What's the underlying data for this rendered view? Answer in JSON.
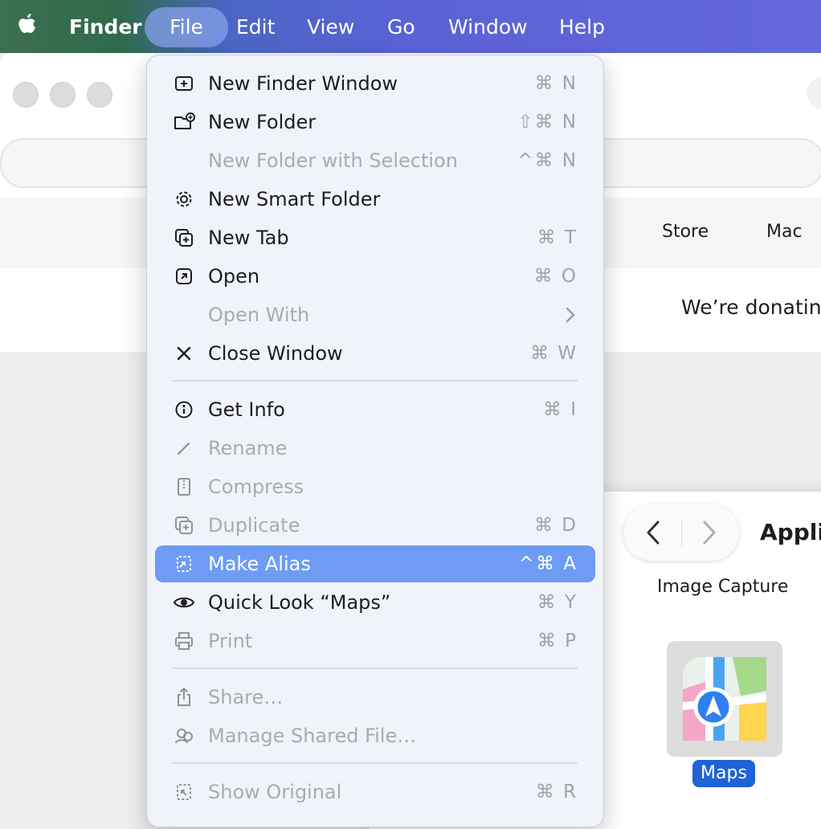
{
  "menubar": {
    "apple_icon": "apple-logo-icon",
    "items": [
      "Finder",
      "File",
      "Edit",
      "View",
      "Go",
      "Window",
      "Help"
    ],
    "active_item": "File"
  },
  "browser": {
    "nav_items": [
      "Store",
      "Mac"
    ],
    "banner_text": "We’re donatin"
  },
  "finder_window": {
    "title": "Applic",
    "above_item_label": "Image Capture",
    "selected_item_label": "Maps",
    "selected_item_icon": "maps-app-icon"
  },
  "file_menu": {
    "items": [
      {
        "label": "New Finder Window",
        "shortcut": "⌘ N",
        "icon": "new-window-icon",
        "enabled": true
      },
      {
        "label": "New Folder",
        "shortcut": "⇧⌘ N",
        "icon": "new-folder-icon",
        "enabled": true
      },
      {
        "label": "New Folder with Selection",
        "shortcut": "^⌘ N",
        "icon": "",
        "enabled": false
      },
      {
        "label": "New Smart Folder",
        "shortcut": "",
        "icon": "gear-icon",
        "enabled": true
      },
      {
        "label": "New Tab",
        "shortcut": "⌘ T",
        "icon": "new-tab-icon",
        "enabled": true
      },
      {
        "label": "Open",
        "shortcut": "⌘ O",
        "icon": "open-arrow-icon",
        "enabled": true
      },
      {
        "label": "Open With",
        "shortcut": "",
        "icon": "",
        "enabled": false,
        "submenu": true
      },
      {
        "label": "Close Window",
        "shortcut": "⌘ W",
        "icon": "close-icon",
        "enabled": true
      },
      {
        "label": "Get Info",
        "shortcut": "⌘ I",
        "icon": "info-icon",
        "enabled": true
      },
      {
        "label": "Rename",
        "shortcut": "",
        "icon": "pencil-icon",
        "enabled": false
      },
      {
        "label": "Compress",
        "shortcut": "",
        "icon": "archive-icon",
        "enabled": false
      },
      {
        "label": "Duplicate",
        "shortcut": "⌘ D",
        "icon": "duplicate-icon",
        "enabled": false
      },
      {
        "label": "Make Alias",
        "shortcut": "^⌘ A",
        "icon": "alias-icon",
        "enabled": true,
        "highlighted": true
      },
      {
        "label": "Quick Look “Maps”",
        "shortcut": "⌘ Y",
        "icon": "eye-icon",
        "enabled": true
      },
      {
        "label": "Print",
        "shortcut": "⌘ P",
        "icon": "printer-icon",
        "enabled": false
      },
      {
        "label": "Share…",
        "shortcut": "",
        "icon": "share-icon",
        "enabled": false
      },
      {
        "label": "Manage Shared File…",
        "shortcut": "",
        "icon": "shared-people-icon",
        "enabled": false
      },
      {
        "label": "Show Original",
        "shortcut": "⌘ R",
        "icon": "show-original-icon",
        "enabled": false
      }
    ]
  },
  "colors": {
    "menu_highlight": "#6e9cf5",
    "selection_blue": "#1f63d6",
    "disabled_text": "#a9abb0"
  }
}
